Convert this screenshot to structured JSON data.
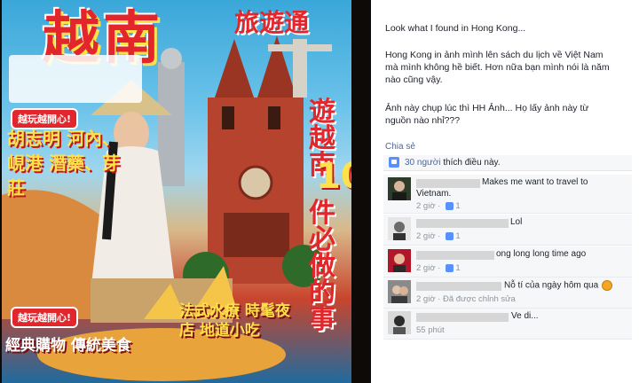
{
  "photo": {
    "cover_title": "越南",
    "cover_subtitle": "旅遊通",
    "cover_vertical_title": "遊越南",
    "cover_number": "10",
    "cover_vertical_tagline": "件必做的事",
    "highlight_badge": "越玩越開心!",
    "city_list": "胡志明 河內、峴港 潛藥、芽莊",
    "bottom_badge": "越玩越開心!",
    "bottom_list": "經典購物 傳統美食",
    "bottom_right_list": "法式水療 時髦夜店 地道小吃",
    "colors": {
      "red": "#e2262b",
      "yellow": "#ffe14a",
      "sky": "#3aa7d9"
    }
  },
  "post": {
    "paragraphs": [
      "Look what I found in Hong Kong...",
      "Hong Kong in ảnh mình lên sách du lịch về Việt Nam mà mình không hề biết. Hơn nữa bạn mình nói là năm nào cũng vậy.",
      "Ảnh này chụp lúc thì HH Ảnh... Họ lấy ảnh này từ nguồn nào nhỉ???"
    ],
    "share_label": "Chia sẻ",
    "likes_count": "30 người",
    "likes_suffix": "thích điều này.",
    "like_color": "#5890ff",
    "link_color": "#4b67a1"
  },
  "comments": [
    {
      "text": "Makes me want to travel to",
      "text2": "Vietnam.",
      "meta": "2 giờ ·",
      "likes": "1"
    },
    {
      "text": "Lol",
      "text2": "",
      "meta": "2 giờ ·",
      "likes": "1"
    },
    {
      "text": "ong long long time ago",
      "text2": "",
      "meta": "2 giờ ·",
      "likes": "1"
    },
    {
      "text": "Nỗ tí của ngày hôm qua",
      "text2": "",
      "meta": "2 giờ · Đã được chỉnh sửa",
      "likes": "1"
    },
    {
      "text": "Ve di...",
      "text2": "",
      "meta": "55 phút",
      "likes": ""
    }
  ]
}
